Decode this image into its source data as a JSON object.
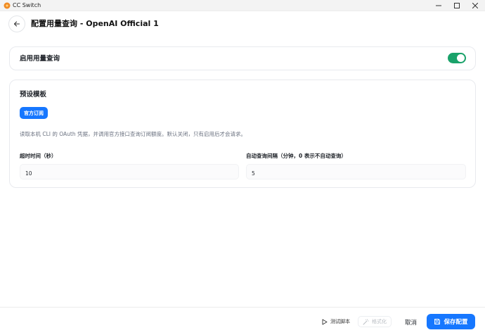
{
  "window": {
    "title": "CC Switch",
    "icon": "cc-switch-app-icon"
  },
  "header": {
    "title": "配置用量查询 - OpenAI Official 1",
    "back_icon": "arrow-left-icon"
  },
  "enable_section": {
    "label": "启用用量查询",
    "enabled": true,
    "accent": "#1aa26a"
  },
  "preset_section": {
    "title": "预设模板",
    "preset_button": "官方订阅",
    "description": "读取本机 CLI 的 OAuth 凭据，并调用官方接口查询订阅额度。默认关闭，只有启用后才会请求。",
    "timeout": {
      "label": "超时时间（秒）",
      "value": "10"
    },
    "interval": {
      "label": "自动查询间隔（分钟，0 表示不自动查询）",
      "value": "5"
    }
  },
  "footer": {
    "test_label": "测试脚本",
    "format_label": "格式化",
    "cancel_label": "取消",
    "save_label": "保存配置"
  },
  "colors": {
    "primary": "#1677ff",
    "toggle_on": "#1aa26a"
  }
}
